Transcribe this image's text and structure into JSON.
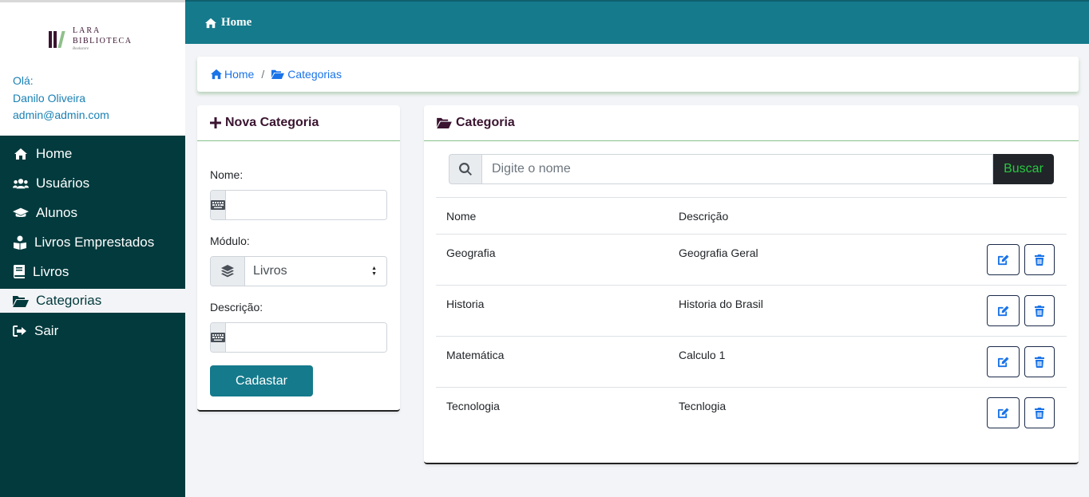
{
  "brand": {
    "line1": "LARA",
    "line2": "BIBLIOTECA",
    "line3": "Bookstore"
  },
  "user": {
    "greeting": "Olá:",
    "name": "Danilo Oliveira",
    "email": "admin@admin.com"
  },
  "sidebar": {
    "items": [
      {
        "label": "Home",
        "icon": "home-icon"
      },
      {
        "label": "Usuários",
        "icon": "users-icon"
      },
      {
        "label": "Alunos",
        "icon": "graduation-cap-icon"
      },
      {
        "label": "Livros Emprestados",
        "icon": "reader-icon"
      },
      {
        "label": "Livros",
        "icon": "book-icon"
      },
      {
        "label": "Categorias",
        "icon": "folder-open-icon",
        "active": true
      },
      {
        "label": "Sair",
        "icon": "sign-out-icon"
      }
    ]
  },
  "topbar": {
    "title": "Home"
  },
  "breadcrumb": {
    "home": "Home",
    "separator": "/",
    "current": "Categorias"
  },
  "new_category": {
    "title": "Nova Categoria",
    "name_label": "Nome:",
    "name_value": "",
    "module_label": "Módulo:",
    "module_value": "Livros",
    "description_label": "Descrição:",
    "description_value": "",
    "submit_label": "Cadastar"
  },
  "category_list": {
    "title": "Categoria",
    "search_placeholder": "Digite o nome",
    "search_button": "Buscar",
    "columns": [
      "Nome",
      "Descrição"
    ],
    "rows": [
      {
        "name": "Geografia",
        "description": "Geografia Geral"
      },
      {
        "name": "Historia",
        "description": "Historia do Brasil"
      },
      {
        "name": "Matemática",
        "description": "Calculo 1"
      },
      {
        "name": "Tecnologia",
        "description": "Tecnlogia"
      }
    ]
  },
  "colors": {
    "sidebar_bg": "#023a3d",
    "topbar_bg": "#147a8c",
    "accent_link": "#1a73e8",
    "title_text": "#3a1430"
  }
}
